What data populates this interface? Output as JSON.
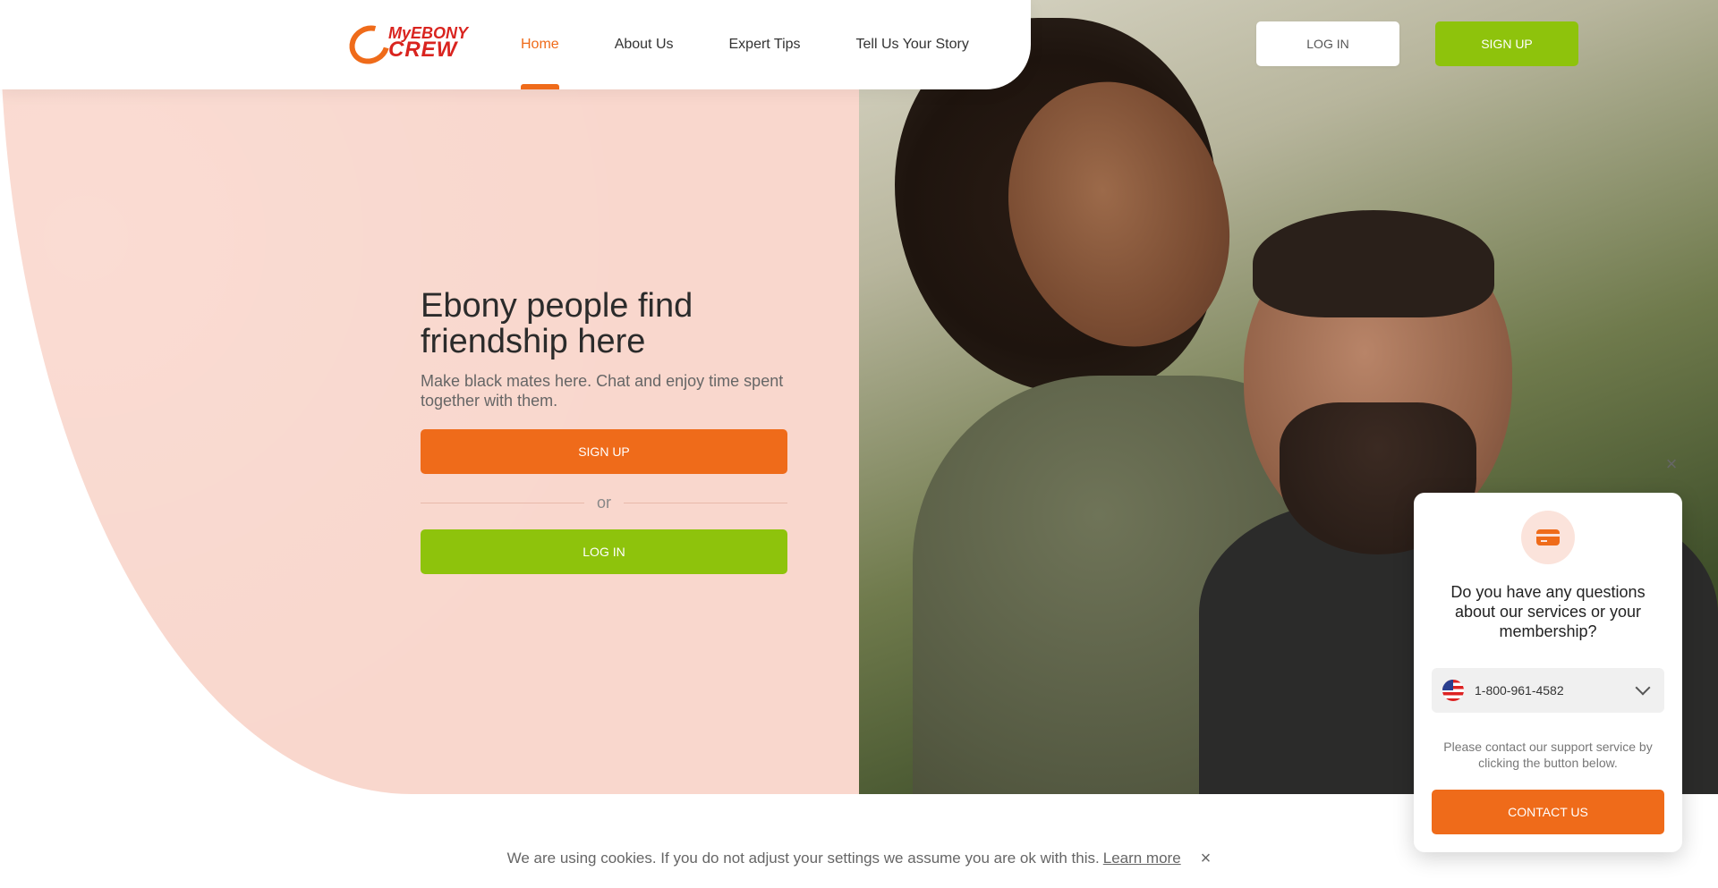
{
  "header": {
    "logo": {
      "top": "MyEBONY",
      "bottom": "CREW"
    },
    "nav": [
      {
        "label": "Home",
        "active": true
      },
      {
        "label": "About Us",
        "active": false
      },
      {
        "label": "Expert Tips",
        "active": false
      },
      {
        "label": "Tell Us Your Story",
        "active": false
      }
    ],
    "login_label": "LOG IN",
    "signup_label": "SIGN UP"
  },
  "hero": {
    "title": "Ebony people find friendship here",
    "subtitle": "Make black mates here. Chat and enjoy time spent together with them.",
    "signup_label": "SIGN UP",
    "or_label": "or",
    "login_label": "LOG IN"
  },
  "support": {
    "close_icon": "×",
    "title": "Do you have any questions about our services or your membership?",
    "phone": "1-800-961-4582",
    "text": "Please contact our support service by clicking the button below.",
    "contact_label": "CONTACT US"
  },
  "cookie": {
    "text": "We are using cookies. If you do not adjust your settings we assume you are ok with this.",
    "link": "Learn more",
    "close_icon": "×"
  },
  "colors": {
    "accent_orange": "#ef6b1a",
    "accent_green": "#8ec30c",
    "hero_pink": "#f9d7cd"
  }
}
